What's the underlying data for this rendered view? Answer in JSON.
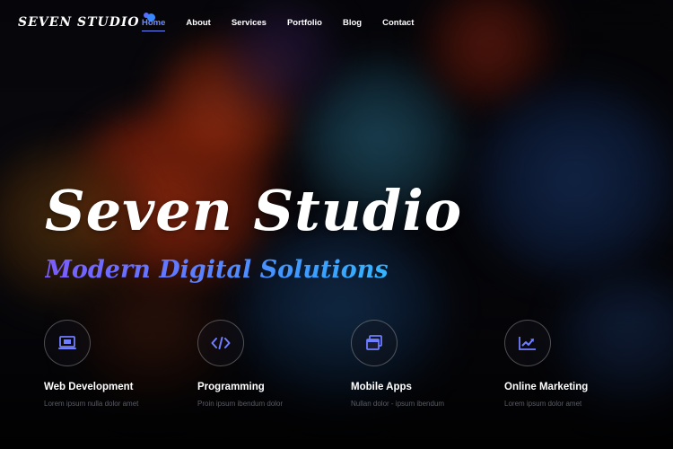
{
  "brand": {
    "name": "SEVEN STUDIO"
  },
  "nav": {
    "items": [
      {
        "label": "Home",
        "active": true
      },
      {
        "label": "About",
        "active": false
      },
      {
        "label": "Services",
        "active": false
      },
      {
        "label": "Portfolio",
        "active": false
      },
      {
        "label": "Blog",
        "active": false
      },
      {
        "label": "Contact",
        "active": false
      }
    ]
  },
  "hero": {
    "title": "Seven Studio",
    "subtitle": "Modern Digital Solutions"
  },
  "features": [
    {
      "icon": "laptop-icon",
      "title": "Web Development",
      "desc": "Lorem ipsum nulla dolor amet"
    },
    {
      "icon": "code-icon",
      "title": "Programming",
      "desc": "Proin ipsum ibendum dolor"
    },
    {
      "icon": "windows-icon",
      "title": "Mobile Apps",
      "desc": "Nullan dolor - ipsum ibendum"
    },
    {
      "icon": "chart-icon",
      "title": "Online Marketing",
      "desc": "Lorem ipsum dolor amet"
    }
  ],
  "colors": {
    "accent": "#6d8bff",
    "icon": "#6f7dff",
    "subtitle_start": "#7b5cff",
    "subtitle_end": "#35b6ff"
  }
}
